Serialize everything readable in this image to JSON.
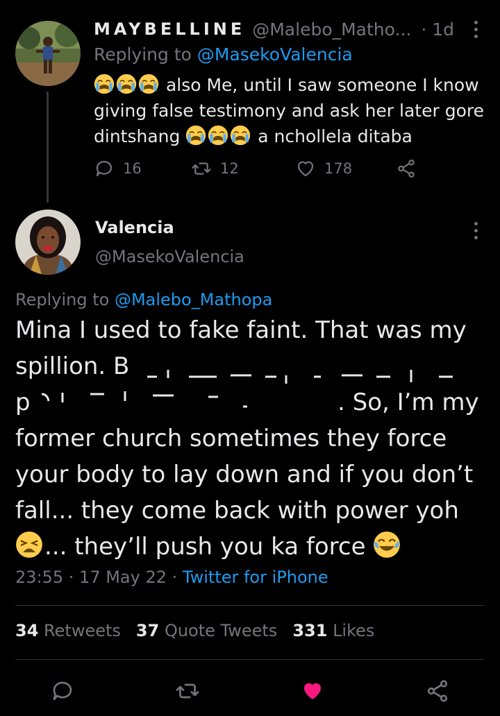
{
  "tweet1": {
    "display_name": "MAYBELLINE",
    "handle": "@Malebo_Matho...",
    "time": "· 1d",
    "replying_prefix": "Replying to ",
    "replying_to": "@MasekoValencia",
    "text_1": " also Me, until I saw someone I know giving false testimony and ask her later gore dintshang ",
    "text_2": " a nchollela ditaba",
    "reply_count": "16",
    "retweet_count": "12",
    "like_count": "178"
  },
  "tweet2": {
    "display_name": "Valencia",
    "handle": "@MasekoValencia",
    "replying_prefix": "Replying to ",
    "replying_to": "@Malebo_Mathopa",
    "line1": "Mina I used to fake faint. That was my",
    "line2": "spillion. B",
    "line3_end": ". So, I’m my",
    "line4": "former church sometimes they force",
    "line5": "your body to lay down and if you don’t",
    "line6": "fall... they come back with power yoh",
    "line7_a": "... they’ll push you ka force",
    "line3_start": "p",
    "timestamp": "23:55 · 17 May 22 ·",
    "source": "Twitter for iPhone",
    "retweets_count": "34",
    "retweets_label": "Retweets",
    "quote_count": "37",
    "quote_label": "Quote Tweets",
    "likes_count": "331",
    "likes_label": "Likes"
  },
  "colors": {
    "background": "#000000",
    "text": "#e7e9ea",
    "muted": "#71767b",
    "link": "#1d9bf0",
    "like": "#f91880"
  }
}
